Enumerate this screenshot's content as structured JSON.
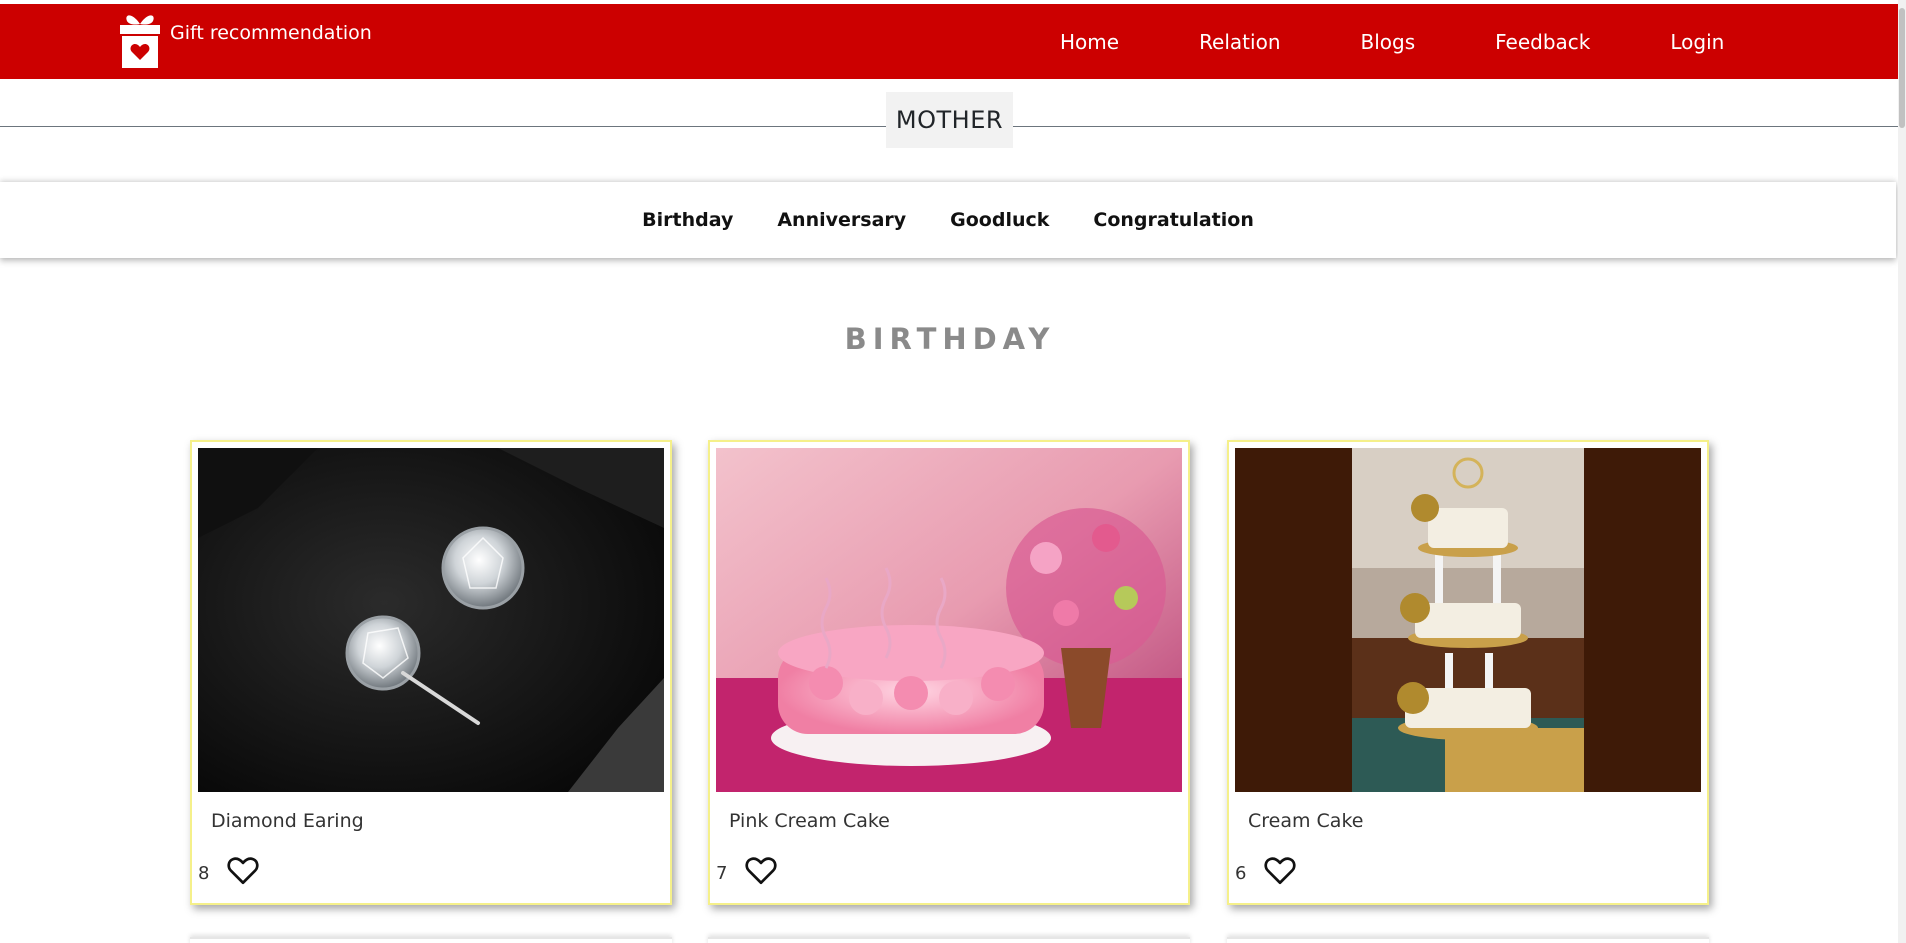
{
  "header": {
    "brand_text": "Gift recommendation",
    "bg_color": "#cc0000",
    "nav": [
      "Home",
      "Relation",
      "Blogs",
      "Feedback",
      "Login"
    ]
  },
  "relation": {
    "title": "MOTHER"
  },
  "occasions": [
    "Birthday",
    "Anniversary",
    "Goodluck",
    "Congratulation"
  ],
  "section": {
    "title": "BIRTHDAY"
  },
  "products": [
    {
      "name": "Diamond Earing",
      "likes": "8",
      "image": "diamond-earrings-photo"
    },
    {
      "name": "Pink Cream Cake",
      "likes": "7",
      "image": "pink-cake-photo"
    },
    {
      "name": "Cream Cake",
      "likes": "6",
      "image": "tiered-cream-cake-photo"
    }
  ],
  "icons": {
    "brand": "gift-heart-icon",
    "like": "heart-outline-icon"
  }
}
